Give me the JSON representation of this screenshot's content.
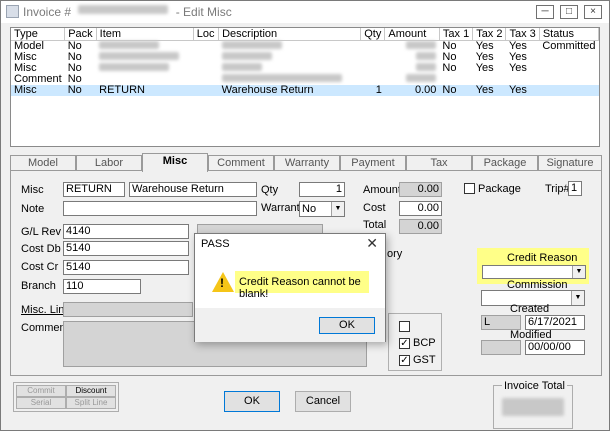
{
  "window": {
    "title_prefix": "Invoice #",
    "title_suffix": "- Edit Misc",
    "minimize_label": "─",
    "restore_label": "□",
    "close_label": "×"
  },
  "grid": {
    "columns": [
      "Type",
      "Pack",
      "Item",
      "Loc",
      "Description",
      "Qty",
      "Amount",
      "Tax 1",
      "Tax 2",
      "Tax 3",
      "Status"
    ],
    "rows": [
      {
        "type": "Model",
        "pack": "No",
        "item": "",
        "loc": "",
        "description": "",
        "qty": "",
        "amount": "",
        "tax1": "No",
        "tax2": "Yes",
        "tax3": "Yes",
        "status": "Committed",
        "selected": false
      },
      {
        "type": "Misc",
        "pack": "No",
        "item": "",
        "loc": "",
        "description": "",
        "qty": "",
        "amount": "",
        "tax1": "No",
        "tax2": "Yes",
        "tax3": "Yes",
        "status": "",
        "selected": false
      },
      {
        "type": "Misc",
        "pack": "No",
        "item": "",
        "loc": "",
        "description": "",
        "qty": "",
        "amount": "",
        "tax1": "No",
        "tax2": "Yes",
        "tax3": "Yes",
        "status": "",
        "selected": false
      },
      {
        "type": "Comment",
        "pack": "No",
        "item": "",
        "loc": "",
        "description": "",
        "qty": "",
        "amount": "",
        "tax1": "",
        "tax2": "",
        "tax3": "",
        "status": "",
        "selected": false
      },
      {
        "type": "Misc",
        "pack": "No",
        "item": "RETURN",
        "loc": "",
        "description": "Warehouse Return",
        "qty": "1",
        "amount": "0.00",
        "tax1": "No",
        "tax2": "Yes",
        "tax3": "Yes",
        "status": "",
        "selected": true
      }
    ]
  },
  "tabs": [
    "Model",
    "Labor",
    "Misc",
    "Comment",
    "Warranty",
    "Payment",
    "Tax",
    "Package",
    "Signature"
  ],
  "form": {
    "misc_label": "Misc",
    "misc_code": "RETURN",
    "misc_desc": "Warehouse Return",
    "note_label": "Note",
    "gl_rev_label": "G/L Rev",
    "gl_rev": "4140",
    "cost_db_label": "Cost Db",
    "cost_db": "5140",
    "cost_cr_label": "Cost Cr",
    "cost_cr": "5140",
    "branch_label": "Branch",
    "branch": "110",
    "misc_link_label": "Misc. Link",
    "comment_label": "Comment",
    "qty_label": "Qty",
    "qty": "1",
    "warranty_label": "Warranty",
    "warranty": "No",
    "amount_label": "Amount",
    "amount": "0.00",
    "cost_label": "Cost",
    "cost": "0.00",
    "total_label": "Total",
    "total": "0.00",
    "partial_label": "ory",
    "package_label": "Package",
    "trip_label": "Trip#",
    "trip": "1",
    "credit_reason_label": "Credit Reason",
    "commission_label": "Commission",
    "created_label": "Created",
    "created_prefix": "L",
    "created_date": "6/17/2021",
    "modified_label": "Modified",
    "modified_date": "00/00/00",
    "bcp_label": "BCP",
    "gst_label": "GST"
  },
  "bottom": {
    "commit": "Commit",
    "discount": "Discount",
    "serial": "Serial",
    "split_line": "Split Line",
    "ok": "OK",
    "cancel": "Cancel",
    "invoice_total_label": "Invoice Total"
  },
  "dialog": {
    "title": "PASS",
    "message": "Credit Reason cannot be blank!",
    "ok": "OK",
    "close": "✕"
  },
  "colors": {
    "highlight": "#ffff88",
    "selection": "#cce8ff",
    "warning": "#f5c518"
  }
}
